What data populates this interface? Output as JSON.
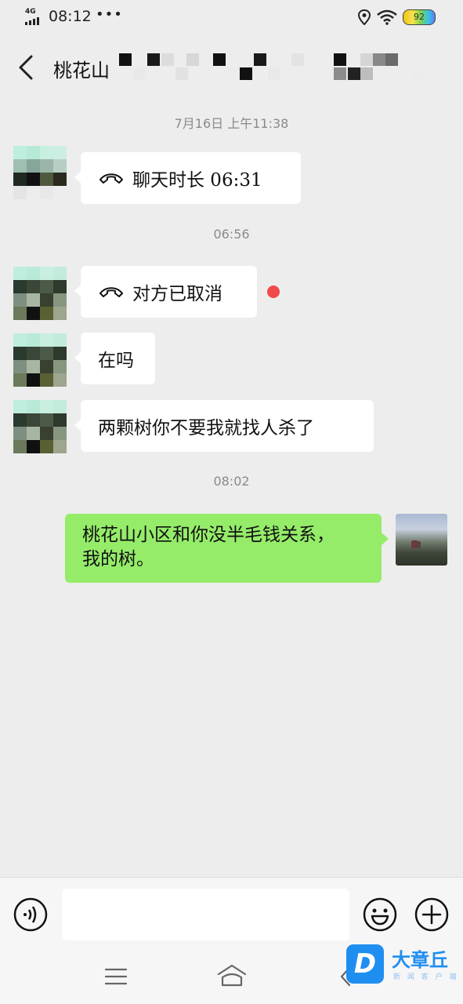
{
  "status_bar": {
    "network": "4G",
    "time": "08:12",
    "dots": "•••",
    "battery": "92"
  },
  "header": {
    "title": "桃花山",
    "back_icon": "chevron-left-icon"
  },
  "messages": [
    {
      "type": "timestamp",
      "text": "7月16日  上午11:38"
    },
    {
      "type": "incoming",
      "kind": "call",
      "icon": "phone-hangup-icon",
      "text": "聊天时长 06:31"
    },
    {
      "type": "timestamp",
      "text": "06:56"
    },
    {
      "type": "incoming",
      "kind": "call",
      "icon": "phone-hangup-icon",
      "text": "对方已取消",
      "unread": true
    },
    {
      "type": "incoming",
      "kind": "text",
      "text": "在吗"
    },
    {
      "type": "incoming",
      "kind": "text",
      "text": "两颗树你不要我就找人杀了"
    },
    {
      "type": "timestamp",
      "text": "08:02"
    },
    {
      "type": "outgoing",
      "kind": "text",
      "text_line1": "桃花山小区和你没半毛钱关系，",
      "text_line2": "我的树。"
    }
  ],
  "input_bar": {
    "voice_icon": "voice-icon",
    "input_value": "",
    "emoji_icon": "emoji-icon",
    "plus_icon": "plus-icon"
  },
  "nav_bar": {
    "menu_icon": "menu-icon",
    "home_icon": "home-icon",
    "back_icon": "back-icon"
  },
  "watermark": {
    "logo_letter": "D",
    "brand": "大章丘",
    "tagline": "新 闻 客 户 端"
  },
  "colors": {
    "background": "#ededed",
    "outgoing_bubble": "#95ec69",
    "incoming_bubble": "#ffffff",
    "unread_dot": "#f04a4a",
    "watermark": "#1f8ef1"
  }
}
